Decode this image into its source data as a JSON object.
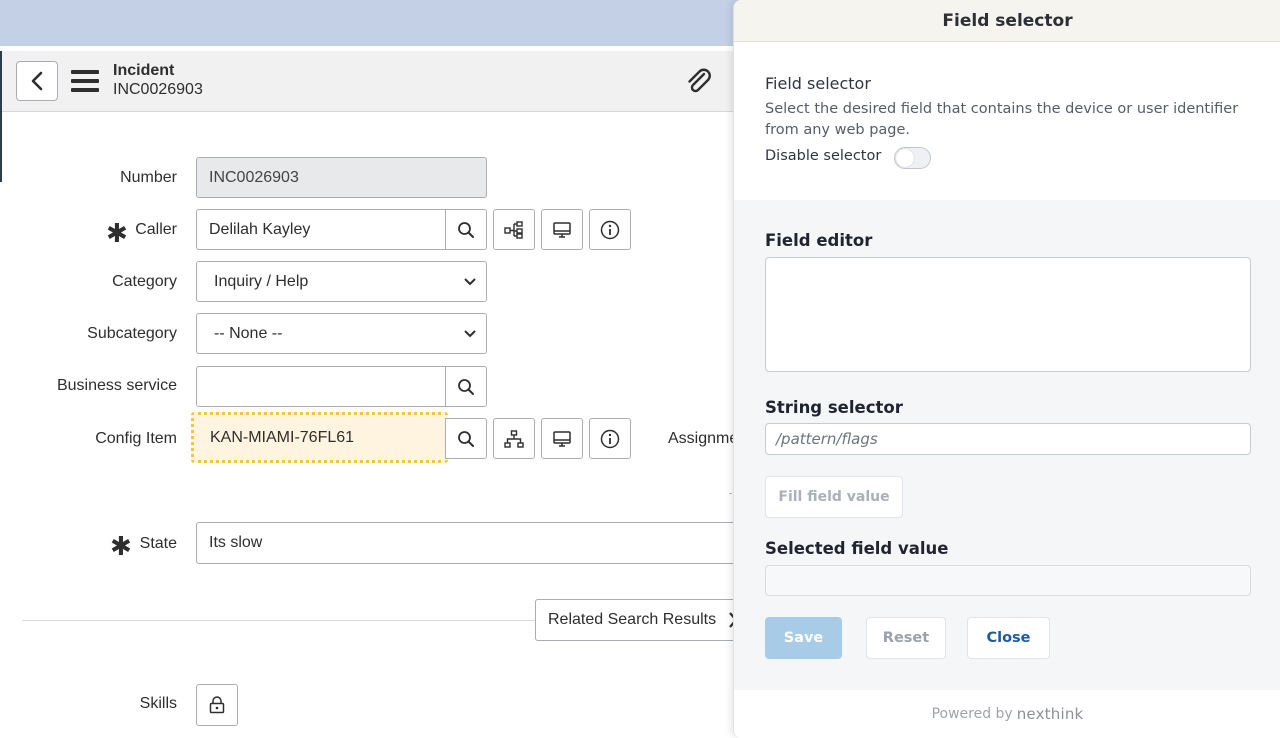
{
  "record": {
    "title": "Incident",
    "number": "INC0026903"
  },
  "form": {
    "number": {
      "label": "Number",
      "value": "INC0026903"
    },
    "caller": {
      "label": "Caller",
      "value": "Delilah Kayley"
    },
    "category": {
      "label": "Category",
      "value": "Inquiry / Help"
    },
    "subcategory": {
      "label": "Subcategory",
      "value": "-- None --"
    },
    "business_service": {
      "label": "Business service",
      "value": ""
    },
    "config_item": {
      "label": "Config Item",
      "value": "KAN-MIAMI-76FL61"
    },
    "assignment_label": "Assignme",
    "state": {
      "label": "State",
      "value": "Its slow"
    },
    "related_button": "Related Search Results",
    "skills": {
      "label": "Skills"
    }
  },
  "panel": {
    "header": "Field selector",
    "selector_title": "Field selector",
    "selector_desc": "Select the desired field that contains the device or user identifier from any web page.",
    "disable_label": "Disable selector",
    "disable_on": false,
    "field_editor_label": "Field editor",
    "field_editor_value": "",
    "string_selector_label": "String selector",
    "string_selector_placeholder": "/pattern/flags",
    "fill_button": "Fill field value",
    "selected_value_label": "Selected field value",
    "selected_value": "",
    "save_button": "Save",
    "reset_button": "Reset",
    "close_button": "Close",
    "powered_by": "Powered by",
    "brand": "nexthink"
  },
  "colors": {
    "accent": "#1c5aa6",
    "save_disabled": "#a8cce8",
    "selected_field_bg": "#fff4e0",
    "selected_field_border": "#f5c443",
    "top_band": "#c4d0e6"
  },
  "icons": {
    "back": "chevron-left-icon",
    "menu": "hamburger-icon",
    "attachment": "paperclip-icon",
    "lookup": "search-icon",
    "tree": "hierarchy-icon",
    "device": "monitor-icon",
    "info": "info-icon",
    "lock": "lock-icon"
  }
}
